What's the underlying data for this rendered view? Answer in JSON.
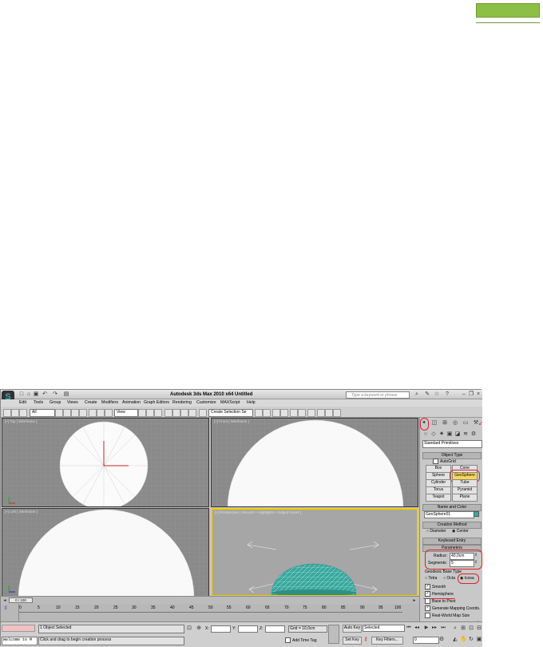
{
  "title": "Autodesk 3ds Max 2010 x64    Untitled",
  "search_placeholder": "Type a keyword or phrase",
  "menu": [
    "Edit",
    "Tools",
    "Group",
    "Views",
    "Create",
    "Modifiers",
    "Animation",
    "Graph Editors",
    "Rendering",
    "Customize",
    "MAXScript",
    "Help"
  ],
  "toolbar": {
    "filter": "All",
    "refcoord": "View",
    "selection_set": "Create Selection Se"
  },
  "viewports": {
    "top": "[+] Top [ Wireframe ]",
    "front": "[+] Front [ Wireframe ]",
    "left": "[+] Left [ Wireframe ]",
    "perspective": "[+] Perspective [ Smooth + Highlights + Edged Faces ]"
  },
  "command_panel": {
    "dropdown": "Standard Primitives",
    "object_type_title": "Object Type",
    "autogrid": "AutoGrid",
    "buttons": [
      "Box",
      "Cone",
      "Sphere",
      "GeoSphere",
      "Cylinder",
      "Tube",
      "Torus",
      "Pyramid",
      "Teapot",
      "Plane"
    ],
    "name_color_title": "Name and Color",
    "object_name": "GeoSphere01",
    "creation_method_title": "Creation Method",
    "creation_methods": [
      "Diameter",
      "Center"
    ],
    "keyboard_entry": "Keyboard Entry",
    "parameters_title": "Parameters",
    "radius_label": "Radius:",
    "radius_value": "40,0cm",
    "segments_label": "Segments:",
    "segments_value": "5",
    "base_type_title": "Geodesic Base Type",
    "base_types": [
      "Tetra",
      "Octa",
      "Icosa"
    ],
    "options": [
      "Smooth",
      "Hemisphere",
      "Base to Pivot",
      "Generate Mapping Coords.",
      "Real-World Map Size"
    ]
  },
  "timeline": {
    "frame": "0 / 100",
    "ticks": [
      "0",
      "5",
      "10",
      "15",
      "20",
      "25",
      "30",
      "35",
      "40",
      "45",
      "50",
      "55",
      "60",
      "65",
      "70",
      "75",
      "80",
      "85",
      "90",
      "95",
      "100"
    ]
  },
  "status": {
    "listener": "Welcome to M",
    "selected": "1 Object Selected",
    "prompt": "Click and drag to begin creation process",
    "x_label": "X:",
    "y_label": "Y:",
    "z_label": "Z:",
    "grid": "Grid = 10,0cm",
    "add_time_tag": "Add Time Tag",
    "auto_key": "Auto Key",
    "auto_key_mode": "Selected",
    "set_key": "Set Key",
    "key_filters": "Key Filters...",
    "frame_field": "0"
  },
  "colors": {
    "geosphere": "#3aa89e",
    "green_tab": "#8cbf46",
    "annotation": "#e0202a"
  }
}
